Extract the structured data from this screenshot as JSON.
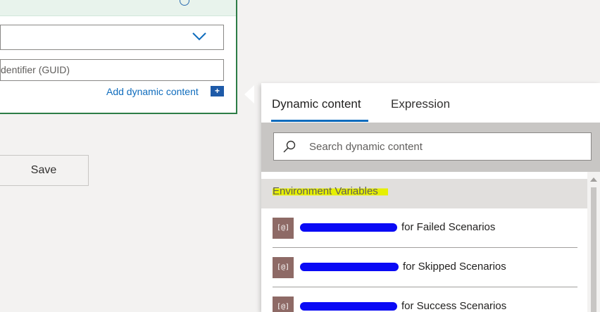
{
  "card": {
    "guid_placeholder": "dentifier (GUID)",
    "add_dynamic_label": "Add dynamic content",
    "add_dynamic_icon": "+"
  },
  "save_label": "Save",
  "flyout": {
    "tabs": [
      "Dynamic content",
      "Expression"
    ],
    "search_placeholder": "Search dynamic content",
    "group": "Environment Variables",
    "items": [
      {
        "icon": "[@]",
        "text": "for Failed Scenarios"
      },
      {
        "icon": "[@]",
        "text": "for Skipped Scenarios"
      },
      {
        "icon": "[@]",
        "text": "for Success Scenarios"
      }
    ]
  },
  "colors": {
    "accent": "#0f6cbd",
    "card_border": "#2d7d46",
    "highlight": "#e6f000",
    "redaction": "#0a0af5",
    "item_icon_bg": "#8e6a66"
  }
}
